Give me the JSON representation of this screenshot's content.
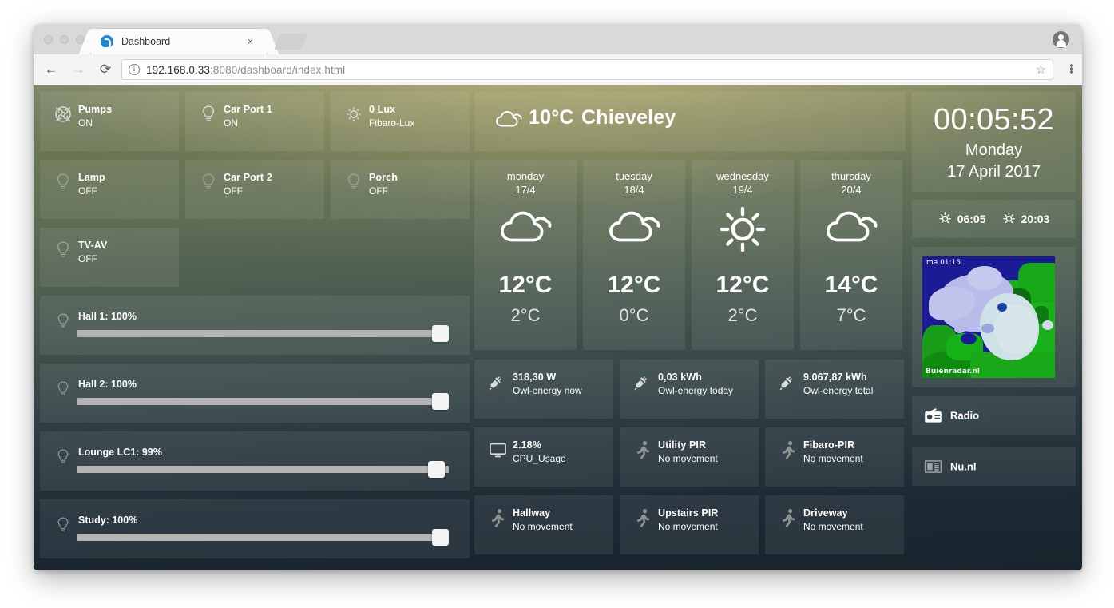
{
  "browser": {
    "tab_title": "Dashboard",
    "favicon": "dashboard-favicon",
    "close_glyph": "×",
    "back_glyph": "←",
    "forward_glyph": "→",
    "reload_glyph": "⟳",
    "info_glyph": "i",
    "star_glyph": "☆",
    "url_host": "192.168.0.33",
    "url_path": ":8080/dashboard/index.html"
  },
  "switches": [
    {
      "name": "Pumps",
      "value": "ON",
      "icon": "fan-icon",
      "on": true
    },
    {
      "name": "Car Port 1",
      "value": "ON",
      "icon": "bulb-icon",
      "on": true
    },
    {
      "name": "0 Lux",
      "value": "Fibaro-Lux",
      "icon": "sun-small-icon",
      "on": true
    },
    {
      "name": "Lamp",
      "value": "OFF",
      "icon": "bulb-icon",
      "on": false
    },
    {
      "name": "Car Port 2",
      "value": "OFF",
      "icon": "bulb-icon",
      "on": false
    },
    {
      "name": "Porch",
      "value": "OFF",
      "icon": "bulb-icon",
      "on": false
    },
    {
      "name": "TV-AV",
      "value": "OFF",
      "icon": "bulb-icon",
      "on": false
    }
  ],
  "dimmers": [
    {
      "label": "Hall 1: 100%",
      "percent": 100,
      "icon": "bulb-icon"
    },
    {
      "label": "Hall 2: 100%",
      "percent": 100,
      "icon": "bulb-icon"
    },
    {
      "label": "Lounge LC1: 99%",
      "percent": 99,
      "icon": "bulb-icon"
    },
    {
      "label": "Study: 100%",
      "percent": 100,
      "icon": "bulb-icon"
    }
  ],
  "weather": {
    "current_temp": "10°C",
    "city": "Chieveley",
    "icon": "cloudy-icon",
    "forecast": [
      {
        "day": "monday",
        "date": "17/4",
        "icon": "cloudy-icon",
        "high": "12°C",
        "low": "2°C"
      },
      {
        "day": "tuesday",
        "date": "18/4",
        "icon": "cloudy-icon",
        "high": "12°C",
        "low": "0°C"
      },
      {
        "day": "wednesday",
        "date": "19/4",
        "icon": "sunny-icon",
        "high": "12°C",
        "low": "2°C"
      },
      {
        "day": "thursday",
        "date": "20/4",
        "icon": "cloudy-icon",
        "high": "14°C",
        "low": "7°C"
      }
    ]
  },
  "sensors": [
    {
      "name": "318,30 W",
      "value": "Owl-energy now",
      "icon": "plug-icon",
      "active": true
    },
    {
      "name": "0,03 kWh",
      "value": "Owl-energy today",
      "icon": "plug-icon",
      "active": true
    },
    {
      "name": "9.067,87 kWh",
      "value": "Owl-energy total",
      "icon": "plug-icon",
      "active": true
    },
    {
      "name": "2.18%",
      "value": "CPU_Usage",
      "icon": "monitor-icon",
      "active": true
    },
    {
      "name": "Utility PIR",
      "value": "No movement",
      "icon": "motion-icon",
      "active": false
    },
    {
      "name": "Fibaro-PIR",
      "value": "No movement",
      "icon": "motion-icon",
      "active": false
    },
    {
      "name": "Hallway",
      "value": "No movement",
      "icon": "motion-icon",
      "active": false
    },
    {
      "name": "Upstairs PIR",
      "value": "No movement",
      "icon": "motion-icon",
      "active": false
    },
    {
      "name": "Driveway",
      "value": "No movement",
      "icon": "motion-icon",
      "active": false
    }
  ],
  "clock": {
    "time": "00:05:52",
    "weekday": "Monday",
    "date": "17 April 2017"
  },
  "sun": {
    "sunrise_icon": "sunrise-icon",
    "sunrise": "06:05",
    "sunset_icon": "sunset-icon",
    "sunset": "20:03"
  },
  "radar": {
    "timestamp": "ma 01:15",
    "source": "Buienradar.nl"
  },
  "links": [
    {
      "label": "Radio",
      "icon": "radio-icon",
      "active": true
    },
    {
      "label": "Nu.nl",
      "icon": "newspaper-icon",
      "active": false
    }
  ],
  "colors": {
    "tile": "#ffffff13",
    "accent_warm": "#d6c880",
    "accent_dark": "#19242d",
    "slider_track": "#b4b4b4",
    "knob": "#f4f4f4"
  }
}
